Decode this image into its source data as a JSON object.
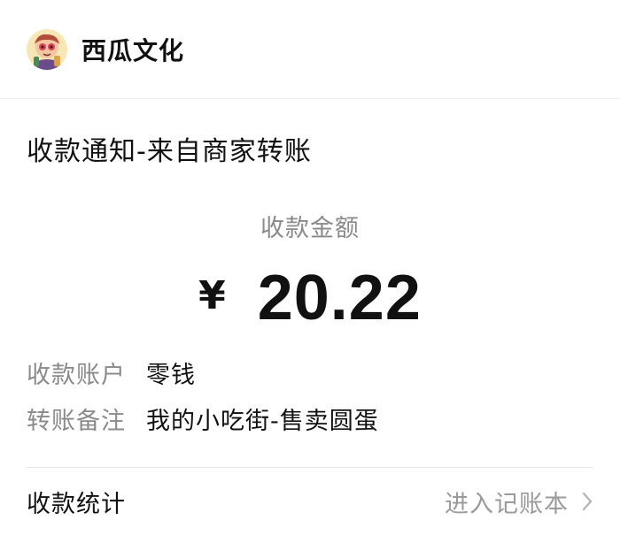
{
  "header": {
    "merchant_name": "西瓜文化",
    "avatar_icon": "cartoon-avatar-icon"
  },
  "notice": {
    "title": "收款通知-来自商家转账"
  },
  "amount": {
    "label": "收款金额",
    "currency": "¥",
    "value": "20.22"
  },
  "details": [
    {
      "label": "收款账户",
      "value": "零钱"
    },
    {
      "label": "转账备注",
      "value": "我的小吃街-售卖圆蛋"
    }
  ],
  "footer": {
    "title": "收款统计",
    "link_label": "进入记账本",
    "link_icon": "chevron-right-icon"
  },
  "colors": {
    "text_primary": "#111111",
    "text_secondary": "#8a8a8a",
    "background": "#ffffff",
    "page_background": "#ededed"
  }
}
